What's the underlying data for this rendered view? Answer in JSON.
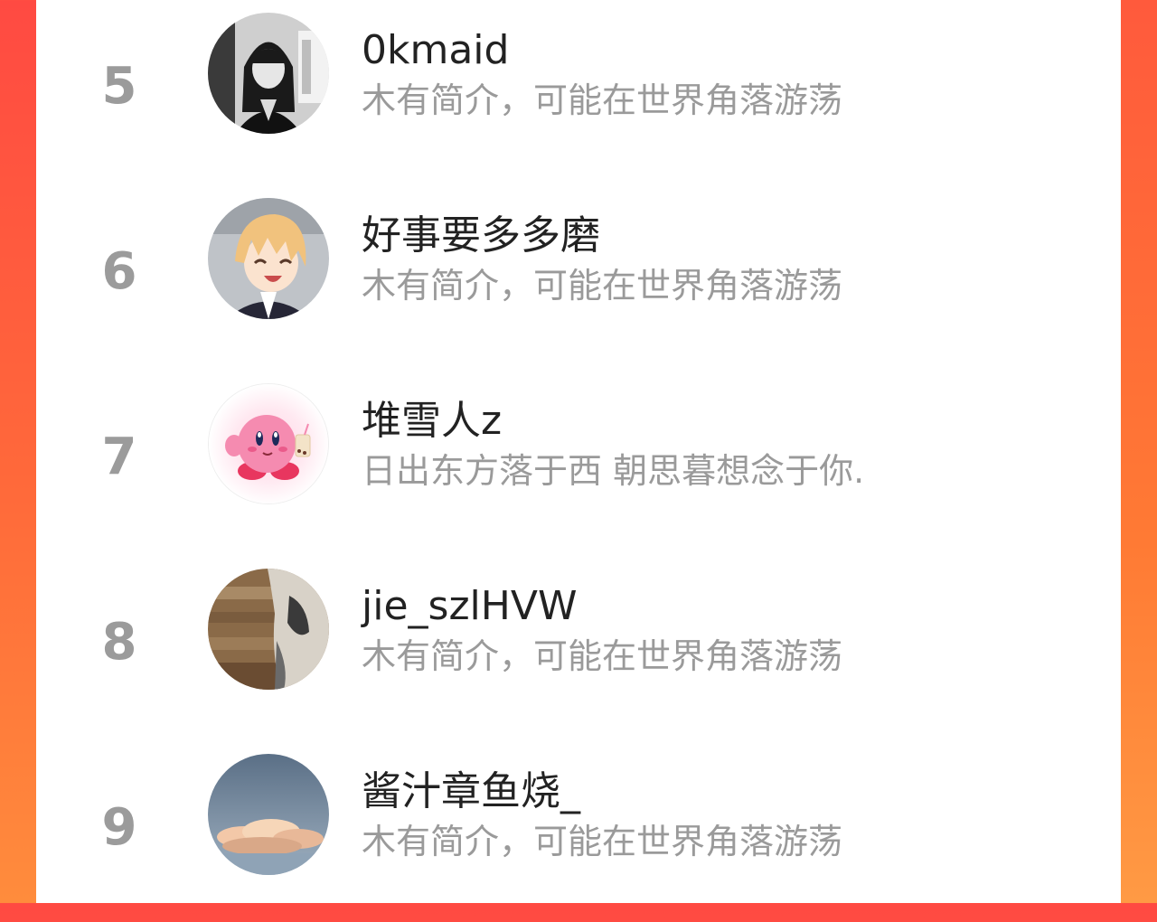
{
  "colors": {
    "background_gradient_top": "#ff4a42",
    "background_gradient_bottom": "#ff8c3c",
    "card": "#ffffff",
    "rank_text": "#9b9b9b",
    "name_text": "#222222",
    "bio_text": "#9a9a9a"
  },
  "users": [
    {
      "rank": "5",
      "name": "0kmaid",
      "bio": "木有简介，可能在世界角落游荡",
      "avatar": "girl-bw-photo-avatar"
    },
    {
      "rank": "6",
      "name": "好事要多多磨",
      "bio": "木有简介，可能在世界角落游荡",
      "avatar": "anime-boy-avatar"
    },
    {
      "rank": "7",
      "name": "堆雪人z",
      "bio": "日出东方落于西 朝思暮想念于你.",
      "avatar": "kirby-avatar"
    },
    {
      "rank": "8",
      "name": "jie_szlHVW",
      "bio": "木有简介，可能在世界角落游荡",
      "avatar": "cat-photo-avatar"
    },
    {
      "rank": "9",
      "name": "酱汁章鱼烧_",
      "bio": "木有简介，可能在世界角落游荡",
      "avatar": "cloud-sky-avatar"
    }
  ]
}
